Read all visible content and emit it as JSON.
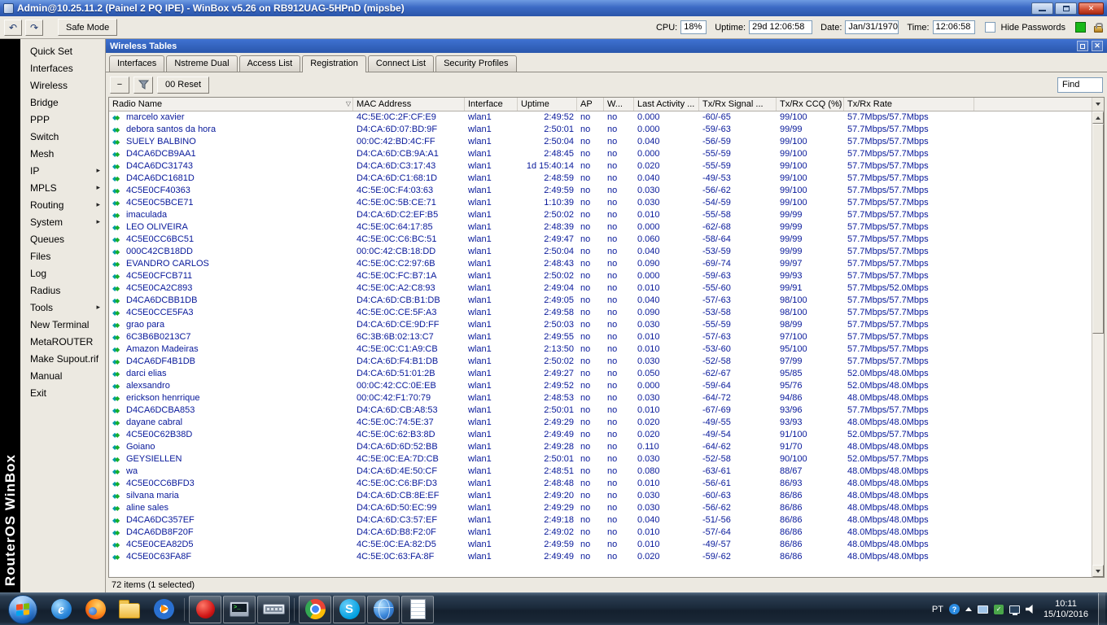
{
  "titlebar": {
    "title": "Admin@10.25.11.2 (Painel 2 PQ IPE) - WinBox v5.26 on RB912UAG-5HPnD (mipsbe)"
  },
  "toolbar": {
    "safe_mode_label": "Safe Mode",
    "cpu_label": "CPU:",
    "cpu_value": "18%",
    "uptime_label": "Uptime:",
    "uptime_value": "29d 12:06:58",
    "date_label": "Date:",
    "date_value": "Jan/31/1970",
    "time_label": "Time:",
    "time_value": "12:06:58",
    "hide_passwords_label": "Hide Passwords"
  },
  "brand": "RouterOS WinBox",
  "sidebar": {
    "items": [
      {
        "label": "Quick Set",
        "submenu": false
      },
      {
        "label": "Interfaces",
        "submenu": false
      },
      {
        "label": "Wireless",
        "submenu": false
      },
      {
        "label": "Bridge",
        "submenu": false
      },
      {
        "label": "PPP",
        "submenu": false
      },
      {
        "label": "Switch",
        "submenu": false
      },
      {
        "label": "Mesh",
        "submenu": false
      },
      {
        "label": "IP",
        "submenu": true
      },
      {
        "label": "MPLS",
        "submenu": true
      },
      {
        "label": "Routing",
        "submenu": true
      },
      {
        "label": "System",
        "submenu": true
      },
      {
        "label": "Queues",
        "submenu": false
      },
      {
        "label": "Files",
        "submenu": false
      },
      {
        "label": "Log",
        "submenu": false
      },
      {
        "label": "Radius",
        "submenu": false
      },
      {
        "label": "Tools",
        "submenu": true
      },
      {
        "label": "New Terminal",
        "submenu": false
      },
      {
        "label": "MetaROUTER",
        "submenu": false
      },
      {
        "label": "Make Supout.rif",
        "submenu": false
      },
      {
        "label": "Manual",
        "submenu": false
      },
      {
        "label": "Exit",
        "submenu": false
      }
    ]
  },
  "panel": {
    "title": "Wireless Tables",
    "tabs": [
      "Interfaces",
      "Nstreme Dual",
      "Access List",
      "Registration",
      "Connect List",
      "Security Profiles"
    ],
    "active_tab": "Registration",
    "remove_button": "−",
    "reset_button": "00 Reset",
    "find_button": "Find",
    "status": "72 items (1 selected)"
  },
  "table": {
    "columns": [
      {
        "label": "Radio Name",
        "sort": true
      },
      {
        "label": "MAC Address",
        "sort": false
      },
      {
        "label": "Interface",
        "sort": false
      },
      {
        "label": "Uptime",
        "sort": false
      },
      {
        "label": "AP",
        "sort": false
      },
      {
        "label": "W...",
        "sort": false
      },
      {
        "label": "Last Activity ...",
        "sort": false
      },
      {
        "label": "Tx/Rx Signal ...",
        "sort": false
      },
      {
        "label": "Tx/Rx CCQ (%)",
        "sort": true
      },
      {
        "label": "Tx/Rx Rate",
        "sort": false
      }
    ],
    "rows": [
      [
        "marcelo xavier",
        "4C:5E:0C:2F:CF:E9",
        "wlan1",
        "2:49:52",
        "no",
        "no",
        "0.000",
        "-60/-65",
        "99/100",
        "57.7Mbps/57.7Mbps"
      ],
      [
        "debora santos da hora",
        "D4:CA:6D:07:BD:9F",
        "wlan1",
        "2:50:01",
        "no",
        "no",
        "0.000",
        "-59/-63",
        "99/99",
        "57.7Mbps/57.7Mbps"
      ],
      [
        "SUELY BALBINO",
        "00:0C:42:BD:4C:FF",
        "wlan1",
        "2:50:04",
        "no",
        "no",
        "0.040",
        "-56/-59",
        "99/100",
        "57.7Mbps/57.7Mbps"
      ],
      [
        "D4CA6DCB9AA1",
        "D4:CA:6D:CB:9A:A1",
        "wlan1",
        "2:48:45",
        "no",
        "no",
        "0.000",
        "-55/-59",
        "99/100",
        "57.7Mbps/57.7Mbps"
      ],
      [
        "D4CA6DC31743",
        "D4:CA:6D:C3:17:43",
        "wlan1",
        "1d 15:40:14",
        "no",
        "no",
        "0.020",
        "-55/-59",
        "99/100",
        "57.7Mbps/57.7Mbps"
      ],
      [
        "D4CA6DC1681D",
        "D4:CA:6D:C1:68:1D",
        "wlan1",
        "2:48:59",
        "no",
        "no",
        "0.040",
        "-49/-53",
        "99/100",
        "57.7Mbps/57.7Mbps"
      ],
      [
        "4C5E0CF40363",
        "4C:5E:0C:F4:03:63",
        "wlan1",
        "2:49:59",
        "no",
        "no",
        "0.030",
        "-56/-62",
        "99/100",
        "57.7Mbps/57.7Mbps"
      ],
      [
        "4C5E0C5BCE71",
        "4C:5E:0C:5B:CE:71",
        "wlan1",
        "1:10:39",
        "no",
        "no",
        "0.030",
        "-54/-59",
        "99/100",
        "57.7Mbps/57.7Mbps"
      ],
      [
        "imaculada",
        "D4:CA:6D:C2:EF:B5",
        "wlan1",
        "2:50:02",
        "no",
        "no",
        "0.010",
        "-55/-58",
        "99/99",
        "57.7Mbps/57.7Mbps"
      ],
      [
        "LEO OLIVEIRA",
        "4C:5E:0C:64:17:85",
        "wlan1",
        "2:48:39",
        "no",
        "no",
        "0.000",
        "-62/-68",
        "99/99",
        "57.7Mbps/57.7Mbps"
      ],
      [
        "4C5E0CC6BC51",
        "4C:5E:0C:C6:BC:51",
        "wlan1",
        "2:49:47",
        "no",
        "no",
        "0.060",
        "-58/-64",
        "99/99",
        "57.7Mbps/57.7Mbps"
      ],
      [
        "000C42CB18DD",
        "00:0C:42:CB:18:DD",
        "wlan1",
        "2:50:04",
        "no",
        "no",
        "0.040",
        "-53/-59",
        "99/99",
        "57.7Mbps/57.7Mbps"
      ],
      [
        "EVANDRO CARLOS",
        "4C:5E:0C:C2:97:6B",
        "wlan1",
        "2:48:43",
        "no",
        "no",
        "0.090",
        "-69/-74",
        "99/97",
        "57.7Mbps/57.7Mbps"
      ],
      [
        "4C5E0CFCB711",
        "4C:5E:0C:FC:B7:1A",
        "wlan1",
        "2:50:02",
        "no",
        "no",
        "0.000",
        "-59/-63",
        "99/93",
        "57.7Mbps/57.7Mbps"
      ],
      [
        "4C5E0CA2C893",
        "4C:5E:0C:A2:C8:93",
        "wlan1",
        "2:49:04",
        "no",
        "no",
        "0.010",
        "-55/-60",
        "99/91",
        "57.7Mbps/52.0Mbps"
      ],
      [
        "D4CA6DCBB1DB",
        "D4:CA:6D:CB:B1:DB",
        "wlan1",
        "2:49:05",
        "no",
        "no",
        "0.040",
        "-57/-63",
        "98/100",
        "57.7Mbps/57.7Mbps"
      ],
      [
        "4C5E0CCE5FA3",
        "4C:5E:0C:CE:5F:A3",
        "wlan1",
        "2:49:58",
        "no",
        "no",
        "0.090",
        "-53/-58",
        "98/100",
        "57.7Mbps/57.7Mbps"
      ],
      [
        "grao para",
        "D4:CA:6D:CE:9D:FF",
        "wlan1",
        "2:50:03",
        "no",
        "no",
        "0.030",
        "-55/-59",
        "98/99",
        "57.7Mbps/57.7Mbps"
      ],
      [
        "6C3B6B0213C7",
        "6C:3B:6B:02:13:C7",
        "wlan1",
        "2:49:55",
        "no",
        "no",
        "0.010",
        "-57/-63",
        "97/100",
        "57.7Mbps/57.7Mbps"
      ],
      [
        "Amazon Madeiras",
        "4C:5E:0C:C1:A9:CB",
        "wlan1",
        "2:13:50",
        "no",
        "no",
        "0.010",
        "-53/-60",
        "95/100",
        "57.7Mbps/57.7Mbps"
      ],
      [
        "D4CA6DF4B1DB",
        "D4:CA:6D:F4:B1:DB",
        "wlan1",
        "2:50:02",
        "no",
        "no",
        "0.030",
        "-52/-58",
        "97/99",
        "57.7Mbps/57.7Mbps"
      ],
      [
        "darci elias",
        "D4:CA:6D:51:01:2B",
        "wlan1",
        "2:49:27",
        "no",
        "no",
        "0.050",
        "-62/-67",
        "95/85",
        "52.0Mbps/48.0Mbps"
      ],
      [
        "alexsandro",
        "00:0C:42:CC:0E:EB",
        "wlan1",
        "2:49:52",
        "no",
        "no",
        "0.000",
        "-59/-64",
        "95/76",
        "52.0Mbps/48.0Mbps"
      ],
      [
        "erickson henrrique",
        "00:0C:42:F1:70:79",
        "wlan1",
        "2:48:53",
        "no",
        "no",
        "0.030",
        "-64/-72",
        "94/86",
        "48.0Mbps/48.0Mbps"
      ],
      [
        "D4CA6DCBA853",
        "D4:CA:6D:CB:A8:53",
        "wlan1",
        "2:50:01",
        "no",
        "no",
        "0.010",
        "-67/-69",
        "93/96",
        "57.7Mbps/57.7Mbps"
      ],
      [
        "dayane cabral",
        "4C:5E:0C:74:5E:37",
        "wlan1",
        "2:49:29",
        "no",
        "no",
        "0.020",
        "-49/-55",
        "93/93",
        "48.0Mbps/48.0Mbps"
      ],
      [
        "4C5E0C62B38D",
        "4C:5E:0C:62:B3:8D",
        "wlan1",
        "2:49:49",
        "no",
        "no",
        "0.020",
        "-49/-54",
        "91/100",
        "52.0Mbps/57.7Mbps"
      ],
      [
        "Goiano",
        "D4:CA:6D:6D:52:BB",
        "wlan1",
        "2:49:28",
        "no",
        "no",
        "0.110",
        "-64/-62",
        "91/70",
        "48.0Mbps/48.0Mbps"
      ],
      [
        "GEYSIELLEN",
        "4C:5E:0C:EA:7D:CB",
        "wlan1",
        "2:50:01",
        "no",
        "no",
        "0.030",
        "-52/-58",
        "90/100",
        "52.0Mbps/57.7Mbps"
      ],
      [
        "wa",
        "D4:CA:6D:4E:50:CF",
        "wlan1",
        "2:48:51",
        "no",
        "no",
        "0.080",
        "-63/-61",
        "88/67",
        "48.0Mbps/48.0Mbps"
      ],
      [
        "4C5E0CC6BFD3",
        "4C:5E:0C:C6:BF:D3",
        "wlan1",
        "2:48:48",
        "no",
        "no",
        "0.010",
        "-56/-61",
        "86/93",
        "48.0Mbps/48.0Mbps"
      ],
      [
        "silvana maria",
        "D4:CA:6D:CB:8E:EF",
        "wlan1",
        "2:49:20",
        "no",
        "no",
        "0.030",
        "-60/-63",
        "86/86",
        "48.0Mbps/48.0Mbps"
      ],
      [
        "aline sales",
        "D4:CA:6D:50:EC:99",
        "wlan1",
        "2:49:29",
        "no",
        "no",
        "0.030",
        "-56/-62",
        "86/86",
        "48.0Mbps/48.0Mbps"
      ],
      [
        "D4CA6DC357EF",
        "D4:CA:6D:C3:57:EF",
        "wlan1",
        "2:49:18",
        "no",
        "no",
        "0.040",
        "-51/-56",
        "86/86",
        "48.0Mbps/48.0Mbps"
      ],
      [
        "D4CA6DB8F20F",
        "D4:CA:6D:B8:F2:0F",
        "wlan1",
        "2:49:02",
        "no",
        "no",
        "0.010",
        "-57/-64",
        "86/86",
        "48.0Mbps/48.0Mbps"
      ],
      [
        "4C5E0CEA82D5",
        "4C:5E:0C:EA:82:D5",
        "wlan1",
        "2:49:59",
        "no",
        "no",
        "0.010",
        "-49/-57",
        "86/86",
        "48.0Mbps/48.0Mbps"
      ],
      [
        "4C5E0C63FA8F",
        "4C:5E:0C:63:FA:8F",
        "wlan1",
        "2:49:49",
        "no",
        "no",
        "0.020",
        "-59/-62",
        "86/86",
        "48.0Mbps/48.0Mbps"
      ]
    ]
  },
  "taskbar": {
    "icons": [
      {
        "name": "internet-explorer",
        "open": false
      },
      {
        "name": "firefox",
        "open": false
      },
      {
        "name": "file-explorer",
        "open": false
      },
      {
        "name": "media-player",
        "open": false
      },
      {
        "name": "sep",
        "sep": true
      },
      {
        "name": "winbox",
        "open": true
      },
      {
        "name": "terminal",
        "open": true
      },
      {
        "name": "keyboard",
        "open": true
      },
      {
        "name": "sep",
        "sep": true
      },
      {
        "name": "chrome",
        "open": true
      },
      {
        "name": "skype",
        "open": true
      },
      {
        "name": "network-globe",
        "open": true
      },
      {
        "name": "notepad",
        "open": true
      }
    ],
    "tray": {
      "language": "PT",
      "time": "10:11",
      "date": "15/10/2016"
    }
  }
}
